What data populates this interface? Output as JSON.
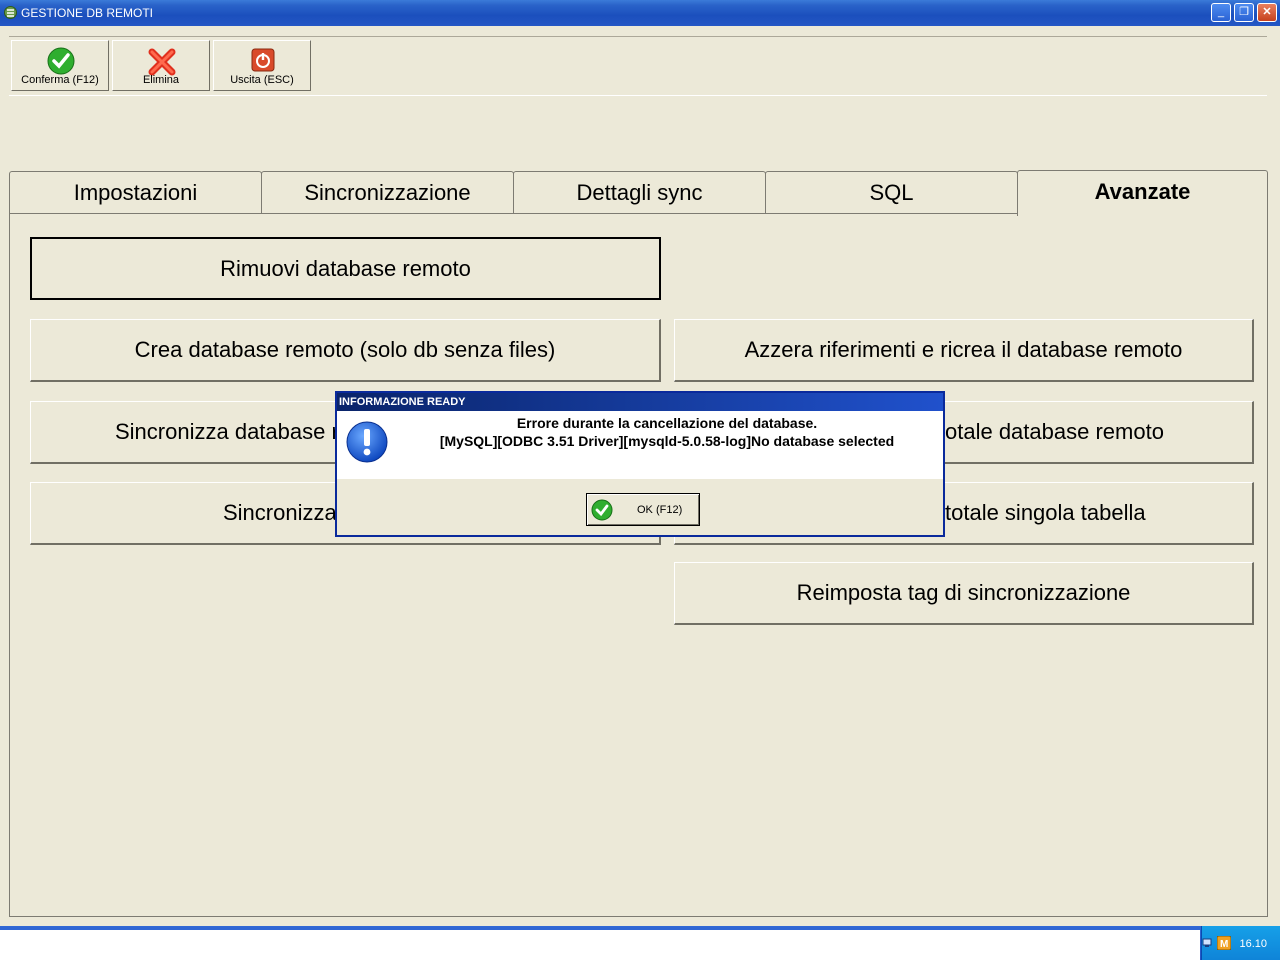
{
  "window": {
    "title": "GESTIONE DB REMOTI"
  },
  "toolbar": {
    "confirm_label": "Conferma (F12)",
    "delete_label": "Elimina",
    "exit_label": "Uscita (ESC)"
  },
  "tabs": [
    {
      "label": "Impostazioni"
    },
    {
      "label": "Sincronizzazione"
    },
    {
      "label": "Dettagli sync"
    },
    {
      "label": "SQL"
    },
    {
      "label": "Avanzate"
    }
  ],
  "panel": {
    "left_buttons": [
      "Rimuovi database remoto",
      "Crea database remoto (solo db senza files)",
      "Sincronizza database re",
      "Sincronizza"
    ],
    "right_buttons": [
      "Azzera riferimenti e ricrea il database remoto",
      "otale database remoto",
      "totale singola tabella",
      "Reimposta tag di sincronizzazione"
    ]
  },
  "dialog": {
    "title": "INFORMAZIONE READY",
    "message_line1": "Errore durante la cancellazione del database.",
    "message_line2": "[MySQL][ODBC 3.51 Driver][mysqld-5.0.58-log]No database selected",
    "ok_label": "OK (F12)"
  },
  "taskbar": {
    "clock": "16.10"
  }
}
